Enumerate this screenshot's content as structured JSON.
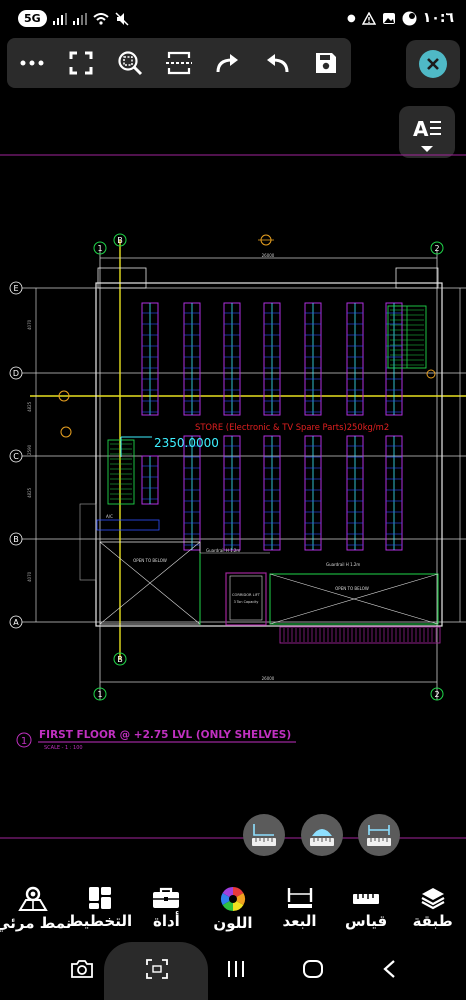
{
  "statusbar": {
    "time": "١٠:٦",
    "network_badge": "5G",
    "right_icons": [
      "warning-icon",
      "gallery-icon",
      "status-dot-icon"
    ],
    "left_icons": [
      "signal-icon",
      "signal-icon",
      "wifi-icon",
      "mute-icon"
    ]
  },
  "toolbar": {
    "buttons": [
      "more-icon",
      "fullscreen-icon",
      "zoom-icon",
      "select-area-icon",
      "redo-icon",
      "undo-icon",
      "save-icon"
    ]
  },
  "close_button": "close-icon",
  "font_button": "text-style-icon",
  "drawing": {
    "store_label": "STORE (Electronic & TV Spare Parts)250kg/m2",
    "coordinate_readout": "2350.0000",
    "grid_letters": [
      "E",
      "D",
      "C",
      "B",
      "A"
    ],
    "grid_numbers_top": [
      "1",
      "2"
    ],
    "grid_b_label": "B",
    "dim_top": "26000",
    "dim_bottom": "26000",
    "open_below_1": "OPEN TO BELOW",
    "open_below_2": "OPEN TO BELOW",
    "lift_label": "CORRIDOR LIFT",
    "lift_sub": "3 Ton Capacity",
    "handrail_1": "Guardrail H 1.2m",
    "handrail_2": "Guardrail H 1.2m",
    "ac_label": "A/C",
    "title_number": "1",
    "title": "FIRST FLOOR  @ +2.75 LVL (ONLY SHELVES)",
    "scale": "SCALE  -  1 : 100",
    "left_dims": [
      "4070",
      "4825",
      "2590",
      "4825",
      "4070"
    ]
  },
  "measure_fabs": [
    "measure-area-icon",
    "measure-arc-icon",
    "measure-length-icon"
  ],
  "bottom_menu": [
    {
      "label": "طبقة",
      "icon": "layers-icon"
    },
    {
      "label": "قياس",
      "icon": "ruler-icon"
    },
    {
      "label": "البعد",
      "icon": "dimension-icon"
    },
    {
      "label": "اللون",
      "icon": "color-wheel-icon"
    },
    {
      "label": "أداة",
      "icon": "toolbox-icon"
    },
    {
      "label": "التخطيط",
      "icon": "layout-icon"
    },
    {
      "label": "نمط مرئي",
      "icon": "visual-style-icon"
    }
  ],
  "navbar": {
    "buttons": [
      "camera-icon",
      "screen-capture-icon",
      "recents-icon",
      "home-icon",
      "back-icon"
    ]
  },
  "colors": {
    "background": "#000000",
    "accent": "#4fb9c6",
    "panel": "#2b2b2b"
  }
}
